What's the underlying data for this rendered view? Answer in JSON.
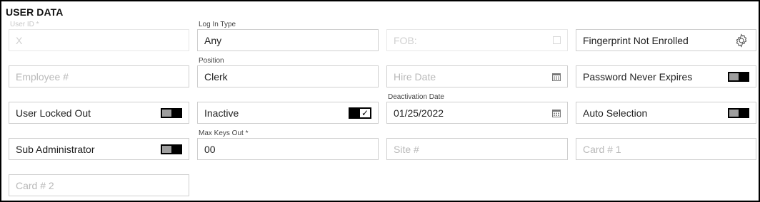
{
  "section_title": "USER DATA",
  "fields": {
    "user_id": {
      "label": "User ID *",
      "value": "X"
    },
    "login_type": {
      "label": "Log In Type",
      "value": "Any"
    },
    "fob": {
      "placeholder": "FOB:"
    },
    "fingerprint": {
      "value": "Fingerprint Not Enrolled",
      "icon": "gear-icon"
    },
    "employee_no": {
      "placeholder": "Employee #"
    },
    "position": {
      "label": "Position",
      "value": "Clerk"
    },
    "hire_date": {
      "placeholder": "Hire Date",
      "icon": "calendar-icon"
    },
    "password_never_expires": {
      "label": "Password Never Expires",
      "state": "off"
    },
    "user_locked_out": {
      "label": "User Locked Out",
      "state": "off"
    },
    "inactive": {
      "label": "Inactive",
      "checked": true
    },
    "deactivation_date": {
      "label": "Deactivation Date",
      "value": "01/25/2022",
      "icon": "calendar-icon"
    },
    "auto_selection": {
      "label": "Auto Selection",
      "state": "off"
    },
    "sub_administrator": {
      "label": "Sub Administrator",
      "state": "off"
    },
    "max_keys_out": {
      "label": "Max Keys Out *",
      "value": "00"
    },
    "site_no": {
      "placeholder": "Site #"
    },
    "card1": {
      "placeholder": "Card # 1"
    },
    "card2": {
      "placeholder": "Card # 2"
    }
  }
}
